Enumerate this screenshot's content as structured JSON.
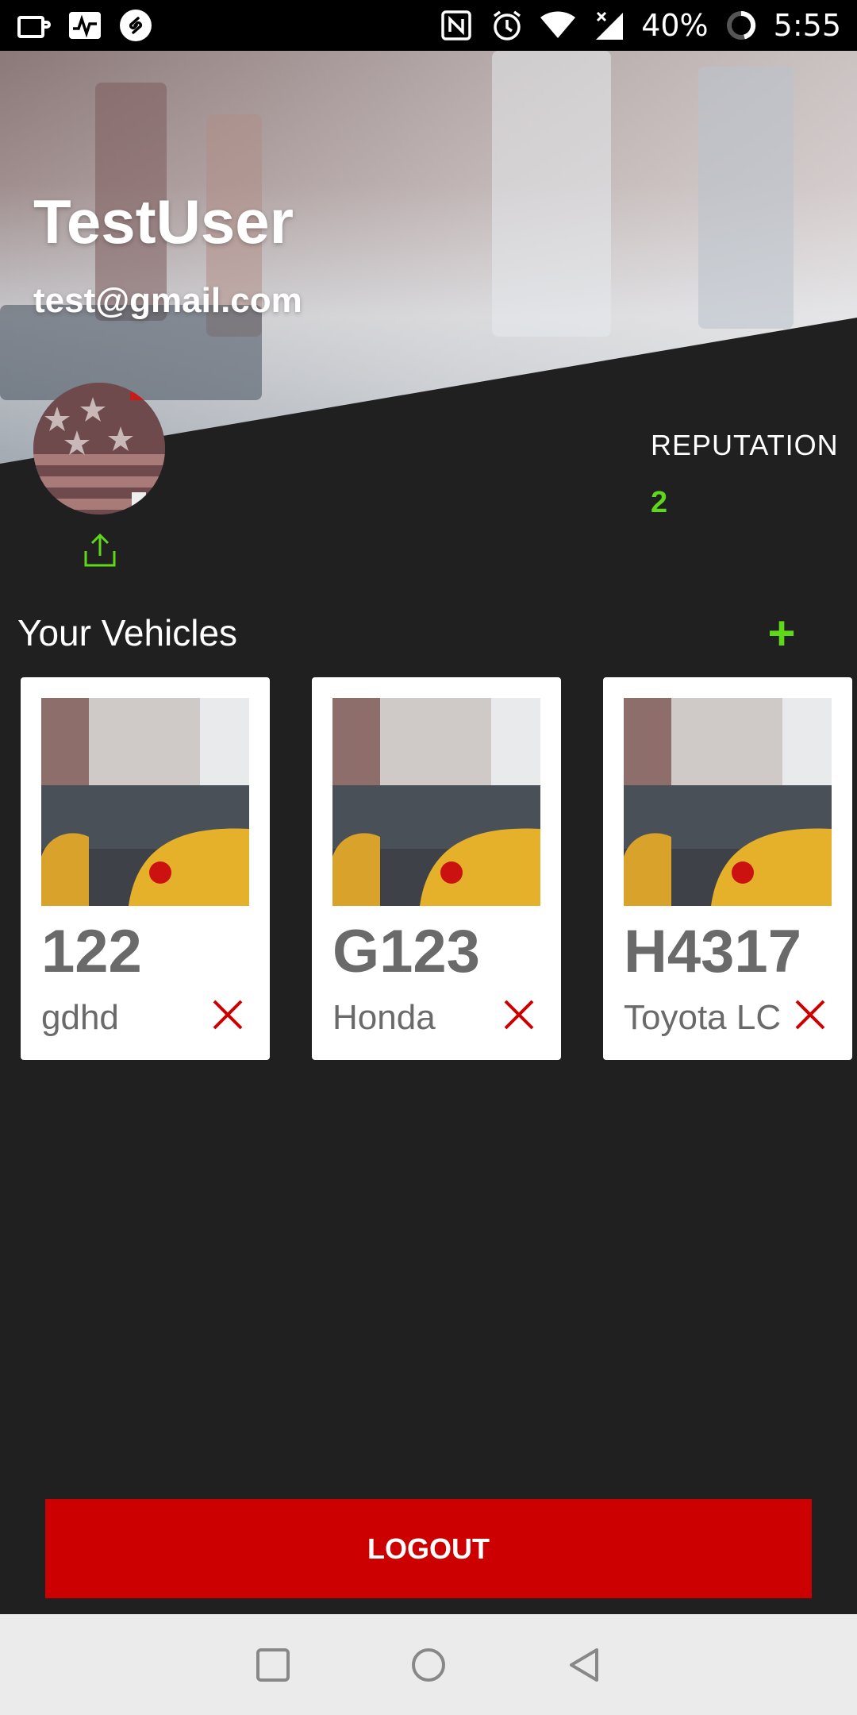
{
  "status_bar": {
    "battery": "40%",
    "time": "5:55",
    "left_icons": [
      "cup-icon",
      "activity-icon",
      "shazam-icon"
    ],
    "right_icons": [
      "nfc-icon",
      "alarm-icon",
      "wifi-icon",
      "signal-icon",
      "battery-ring-icon"
    ]
  },
  "profile": {
    "name": "TestUser",
    "email": "test@gmail.com"
  },
  "reputation": {
    "label": "REPUTATION",
    "value": "2"
  },
  "vehicles": {
    "title": "Your Vehicles",
    "add_label": "+",
    "items": [
      {
        "plate": "122",
        "model": "gdhd"
      },
      {
        "plate": "G123",
        "model": "Honda"
      },
      {
        "plate": "H4317",
        "model": "Toyota LC"
      }
    ]
  },
  "logout": {
    "label": "LOGOUT"
  },
  "colors": {
    "accent_green": "#5fd81c",
    "danger_red": "#cc0000",
    "background": "#202020"
  }
}
